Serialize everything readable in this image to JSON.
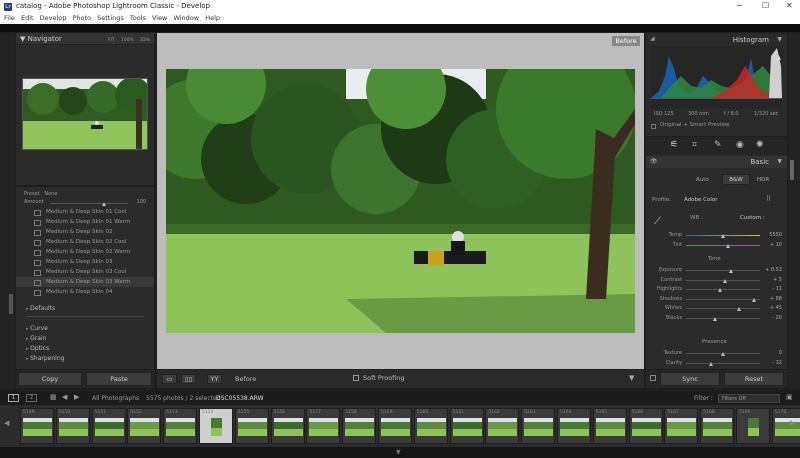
{
  "window": {
    "title": "catalog - Adobe Photoshop Lightroom Classic - Develop",
    "icon_text": "Lr"
  },
  "menu": [
    "File",
    "Edit",
    "Develop",
    "Photo",
    "Settings",
    "Tools",
    "View",
    "Window",
    "Help"
  ],
  "navigator": {
    "title": "Navigator",
    "zoom_levels": [
      "FIT",
      "100%",
      "33%"
    ]
  },
  "presets": {
    "col_preset": "Preset",
    "col_none": "None",
    "amount_label": "Amount",
    "amount_value": "100",
    "items": [
      "Medium & Deep Skin 01 Cool",
      "Medium & Deep Skin 01 Warm",
      "Medium & Deep Skin 02",
      "Medium & Deep Skin 02 Cool",
      "Medium & Deep Skin 02 Warm",
      "Medium & Deep Skin 03",
      "Medium & Deep Skin 03 Cool",
      "Medium & Deep Skin 03 Warm",
      "Medium & Deep Skin 04"
    ],
    "defaults": "Defaults",
    "sections": [
      "Curve",
      "Grain",
      "Optics",
      "Sharpening"
    ]
  },
  "left_footer": {
    "copy": "Copy",
    "paste": "Paste"
  },
  "view": {
    "before_label": "Before"
  },
  "toolbar": {
    "mode": "Before",
    "soft_proofing": "Soft Proofing"
  },
  "histogram": {
    "title": "Histogram",
    "iso": "ISO 125",
    "focal": "300 mm",
    "aperture": "f / 8.0",
    "shutter": "1/320 sec",
    "smart_preview": "Original + Smart Preview"
  },
  "basic": {
    "title": "Basic",
    "modes": [
      "Auto",
      "B&W",
      "HDR"
    ],
    "profile_label": "Profile:",
    "profile_value": "Adobe Color",
    "wb_label": "WB :",
    "wb_value": "Custom :",
    "temp": {
      "name": "Temp",
      "value": "5550"
    },
    "tint": {
      "name": "Tint",
      "value": "+ 10"
    },
    "tone_label": "Tone",
    "tone": [
      {
        "name": "Exposure",
        "value": "+ 0.53",
        "pos": 0.62
      },
      {
        "name": "Contrast",
        "value": "+ 5",
        "pos": 0.54
      },
      {
        "name": "Highlights",
        "value": "- 11",
        "pos": 0.46
      },
      {
        "name": "Shadows",
        "value": "+ 88",
        "pos": 0.93
      },
      {
        "name": "Whites",
        "value": "+ 45",
        "pos": 0.72
      },
      {
        "name": "Blacks",
        "value": "- 20",
        "pos": 0.4
      }
    ],
    "presence_label": "Presence",
    "presence": [
      {
        "name": "Texture",
        "value": "0",
        "pos": 0.5
      },
      {
        "name": "Clarity",
        "value": "- 32",
        "pos": 0.34
      }
    ]
  },
  "right_footer": {
    "sync": "Sync",
    "reset": "Reset"
  },
  "filmstrip_bar": {
    "pages": [
      "1",
      "2"
    ],
    "source": "All Photographs",
    "count": "5575 photos / 2 selected",
    "filename": "DSC05538.ARW",
    "filter_label": "Filter :",
    "filter_value": "Filters Off"
  },
  "filmstrip": [
    "5149",
    "5150",
    "5151",
    "5152",
    "5153",
    "5154",
    "5155",
    "5156",
    "5157",
    "5158",
    "5159",
    "5160",
    "5161",
    "5162",
    "5163",
    "5164",
    "5165",
    "5166",
    "5167",
    "5168",
    "5169",
    "5170"
  ]
}
